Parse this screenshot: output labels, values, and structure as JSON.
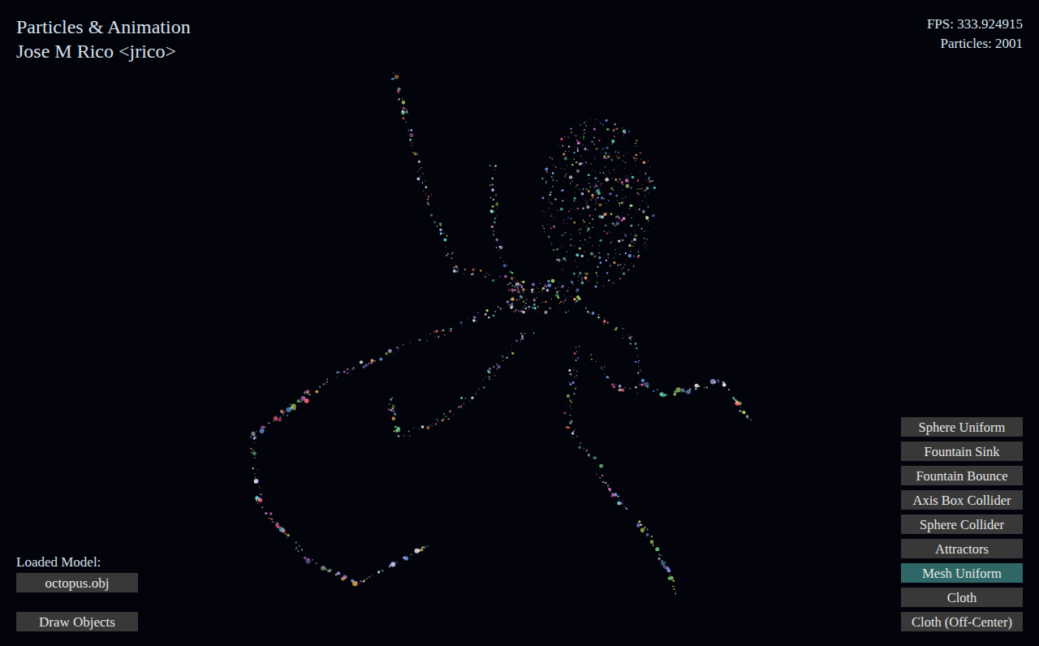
{
  "window": {
    "title": "Particles & Animation",
    "author": "Jose M Rico <jrico>"
  },
  "stats": {
    "fps": "FPS: 333.924915",
    "particles": "Particles: 2001"
  },
  "model": {
    "label": "Loaded Model:",
    "file": "octopus.obj"
  },
  "draw_objects": {
    "label": "Draw Objects"
  },
  "modes": [
    {
      "label": "Sphere Uniform",
      "selected": false
    },
    {
      "label": "Fountain Sink",
      "selected": false
    },
    {
      "label": "Fountain Bounce",
      "selected": false
    },
    {
      "label": "Axis Box Collider",
      "selected": false
    },
    {
      "label": "Sphere Collider",
      "selected": false
    },
    {
      "label": "Attractors",
      "selected": false
    },
    {
      "label": "Mesh Uniform",
      "selected": true
    },
    {
      "label": "Cloth",
      "selected": false
    },
    {
      "label": "Cloth (Off-Center)",
      "selected": false
    }
  ]
}
